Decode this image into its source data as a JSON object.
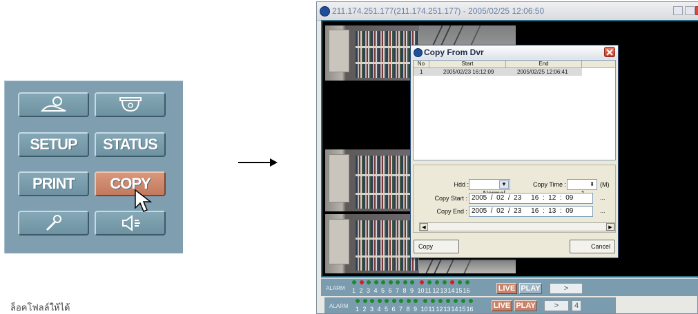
{
  "panel": {
    "buttons": [
      {
        "id": "person",
        "label": "",
        "icon": "person-icon"
      },
      {
        "id": "camera",
        "label": "",
        "icon": "dome-camera-icon"
      },
      {
        "id": "setup",
        "label": "SETUP"
      },
      {
        "id": "status",
        "label": "STATUS"
      },
      {
        "id": "print",
        "label": "PRINT"
      },
      {
        "id": "copy",
        "label": "COPY",
        "active": true
      },
      {
        "id": "mic",
        "label": "",
        "icon": "microphone-icon"
      },
      {
        "id": "speaker",
        "label": "",
        "icon": "speaker-icon"
      }
    ]
  },
  "fragment_text": "ล็อคโฟลล์ให้ได้",
  "window": {
    "title": "211.174.251.177(211.174.251.177) - 2005/02/25 12:06:50"
  },
  "dialog": {
    "title": "Copy From Dvr",
    "columns": [
      "No",
      "Start",
      "End"
    ],
    "rows": [
      {
        "no": "1",
        "start": "2005/02/23 16:12:09",
        "end": "2005/02/25 12:06:41"
      }
    ],
    "hdd_label": "Hdd :",
    "hdd_value": "Normal",
    "copy_time_label": "Copy Time :",
    "copy_time_value": "1",
    "copy_time_unit": "(M)",
    "copy_start_label": "Copy Start :",
    "copy_start_value": "2005  /  02  /  23     16  :  12  :  09",
    "copy_end_label": "Copy End :",
    "copy_end_value": "2005  /  02  /  23     16  :  13  :  09",
    "ellipsis": "...",
    "copy_button": "Copy",
    "cancel_button": "Cancel"
  },
  "alarm": {
    "label": "ALARM",
    "numbers": [
      "1",
      "2",
      "3",
      "4",
      "5",
      "6",
      "7",
      "8",
      "9",
      "10",
      "11",
      "12",
      "13",
      "14",
      "15",
      "16"
    ],
    "active_leds_bar1": [
      2,
      10,
      14
    ],
    "live": "LIVE",
    "play": "PLAY",
    "next": ">",
    "page": "4"
  },
  "colors": {
    "panel_bg": "#7f9fb1",
    "active_button": "#c9836a",
    "led_green": "#1a8a2a",
    "led_red": "#d22020"
  }
}
